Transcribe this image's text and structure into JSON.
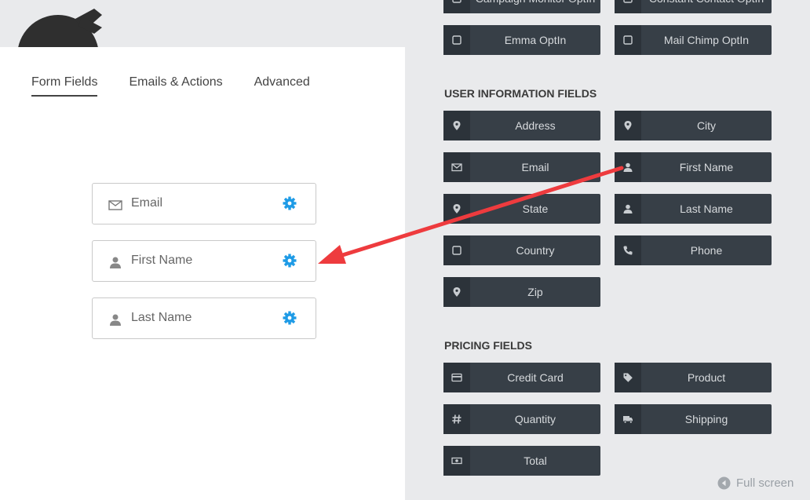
{
  "tabs": [
    "Form Fields",
    "Emails & Actions",
    "Advanced"
  ],
  "form_fields": [
    {
      "label": "Email",
      "icon": "envelope-icon"
    },
    {
      "label": "First Name",
      "icon": "user-icon"
    },
    {
      "label": "Last Name",
      "icon": "user-icon"
    }
  ],
  "top_buttons": [
    {
      "label": "Campaign Monitor OptIn"
    },
    {
      "label": "Constant Contact OptIn"
    },
    {
      "label": "Emma OptIn"
    },
    {
      "label": "Mail Chimp OptIn"
    }
  ],
  "sections": {
    "user_info": "USER INFORMATION FIELDS",
    "pricing": "PRICING FIELDS"
  },
  "user_info_buttons": [
    {
      "label": "Address",
      "icon": "map-marker-icon"
    },
    {
      "label": "City",
      "icon": "map-marker-icon"
    },
    {
      "label": "Email",
      "icon": "envelope-icon"
    },
    {
      "label": "First Name",
      "icon": "user-icon"
    },
    {
      "label": "State",
      "icon": "map-marker-icon"
    },
    {
      "label": "Last Name",
      "icon": "user-icon"
    },
    {
      "label": "Country",
      "icon": "checkbox-icon"
    },
    {
      "label": "Phone",
      "icon": "phone-icon"
    },
    {
      "label": "Zip",
      "icon": "map-marker-icon"
    }
  ],
  "pricing_buttons": [
    {
      "label": "Credit Card",
      "icon": "credit-card-icon"
    },
    {
      "label": "Product",
      "icon": "tag-icon"
    },
    {
      "label": "Quantity",
      "icon": "hash-icon"
    },
    {
      "label": "Shipping",
      "icon": "truck-icon"
    },
    {
      "label": "Total",
      "icon": "money-icon"
    }
  ],
  "fullscreen_label": "Full screen",
  "colors": {
    "button_bg": "#373f47",
    "gear": "#1e9be6",
    "arrow": "#ee3b3e"
  }
}
